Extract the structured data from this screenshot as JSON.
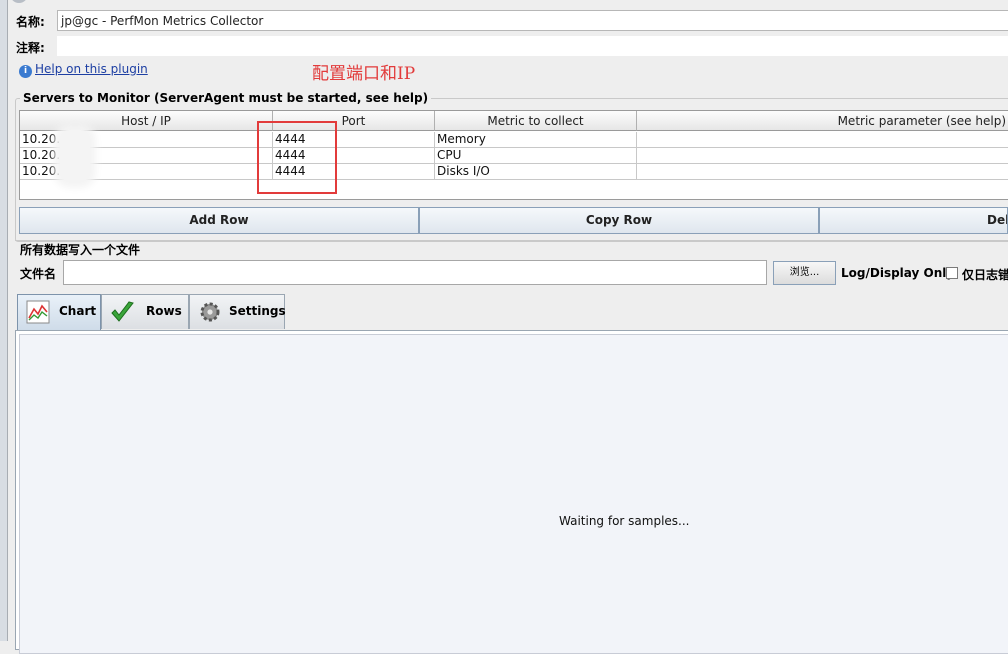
{
  "name_label": "名称:",
  "name_value": "jp@gc - PerfMon Metrics Collector",
  "comment_label": "注释:",
  "help_link": "Help on this plugin",
  "annotation": "配置端口和IP",
  "servers_group": {
    "title": "Servers to Monitor (ServerAgent must be started, see help)",
    "columns": [
      "Host / IP",
      "Port",
      "Metric to collect",
      "Metric parameter (see help)"
    ],
    "rows": [
      {
        "host": "10.20.4",
        "port": "4444",
        "metric": "Memory",
        "param": ""
      },
      {
        "host": "10.20.4",
        "port": "4444",
        "metric": "CPU",
        "param": ""
      },
      {
        "host": "10.20.4",
        "port": "4444",
        "metric": "Disks I/O",
        "param": ""
      }
    ]
  },
  "buttons": {
    "add_row": "Add Row",
    "copy_row": "Copy Row",
    "delete_row": "Dele"
  },
  "file_section": {
    "title": "所有数据写入一个文件",
    "file_label": "文件名",
    "file_value": "",
    "browse": "浏览...",
    "log_display_only": "Log/Display Only:",
    "errors_only": "仅日志错"
  },
  "tabs": [
    {
      "label": "Chart",
      "icon": "chart-icon",
      "active": true
    },
    {
      "label": "Rows",
      "icon": "checkmark-icon",
      "active": false
    },
    {
      "label": "Settings",
      "icon": "gear-icon",
      "active": false
    }
  ],
  "chart_status": "Waiting for samples...",
  "colors": {
    "annotation_red": "#e23b3b",
    "link_blue": "#1d3fa3"
  }
}
